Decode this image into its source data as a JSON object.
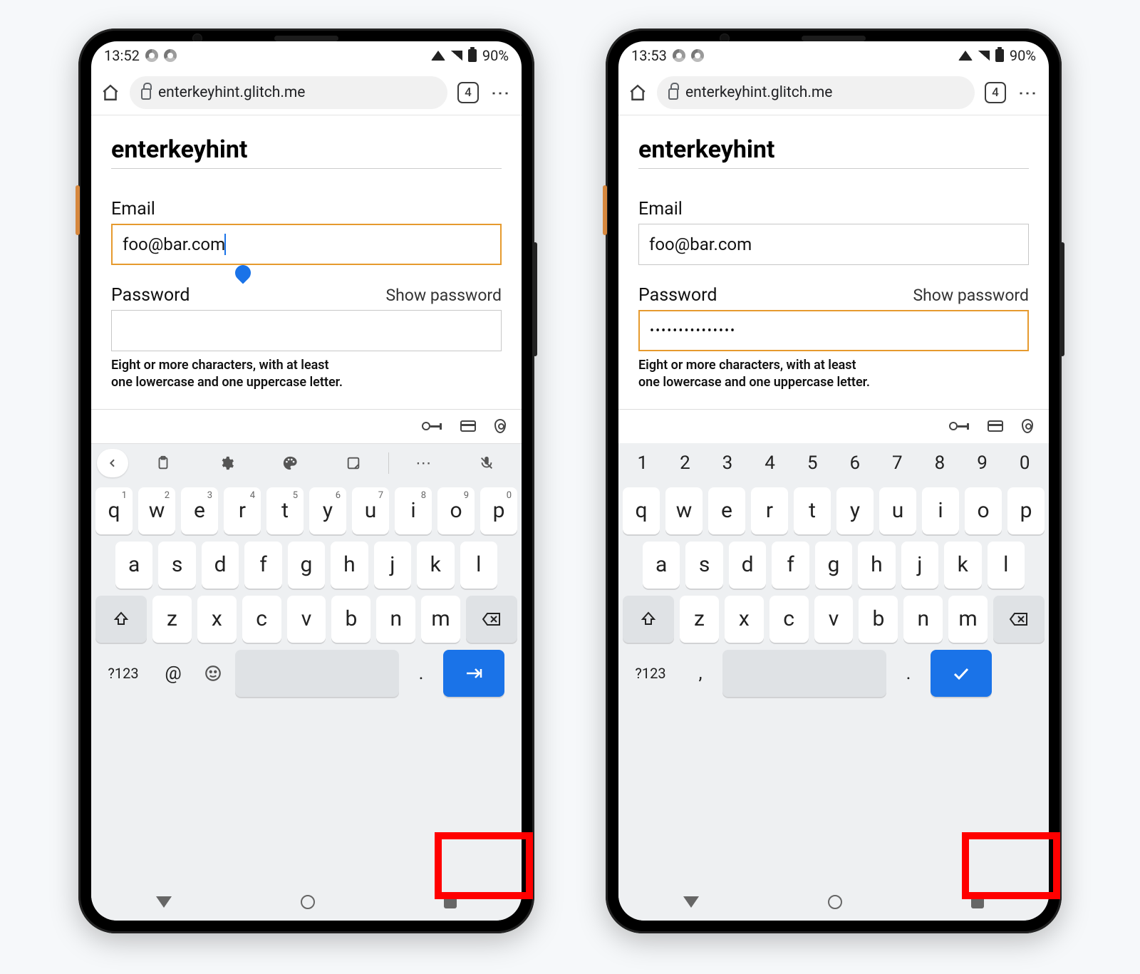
{
  "phones": [
    {
      "status": {
        "time": "13:52",
        "battery": "90%"
      },
      "browser": {
        "url": "enterkeyhint.glitch.me",
        "tab_count": "4"
      },
      "page": {
        "heading": "enterkeyhint",
        "email_label": "Email",
        "email_value": "foo@bar.com",
        "email_focused": true,
        "password_label": "Password",
        "show_password": "Show password",
        "password_value": "",
        "password_focused": false,
        "hint_line1": "Eight or more characters, with at least",
        "hint_line2": "one lowercase and one uppercase letter."
      },
      "keyboard": {
        "has_gboard_toolbar": true,
        "has_number_row": false,
        "row1": [
          "q",
          "w",
          "e",
          "r",
          "t",
          "y",
          "u",
          "i",
          "o",
          "p"
        ],
        "row1_sup": [
          "1",
          "2",
          "3",
          "4",
          "5",
          "6",
          "7",
          "8",
          "9",
          "0"
        ],
        "row2": [
          "a",
          "s",
          "d",
          "f",
          "g",
          "h",
          "j",
          "k",
          "l"
        ],
        "row3": [
          "z",
          "x",
          "c",
          "v",
          "b",
          "n",
          "m"
        ],
        "q123": "?123",
        "last_left1": "@",
        "last_left2": "emoji",
        "dot": ".",
        "enter_type": "next"
      }
    },
    {
      "status": {
        "time": "13:53",
        "battery": "90%"
      },
      "browser": {
        "url": "enterkeyhint.glitch.me",
        "tab_count": "4"
      },
      "page": {
        "heading": "enterkeyhint",
        "email_label": "Email",
        "email_value": "foo@bar.com",
        "email_focused": false,
        "password_label": "Password",
        "show_password": "Show password",
        "password_value": "•••••••••••••••",
        "password_focused": true,
        "hint_line1": "Eight or more characters, with at least",
        "hint_line2": "one lowercase and one uppercase letter."
      },
      "keyboard": {
        "has_gboard_toolbar": false,
        "has_number_row": true,
        "numrow": [
          "1",
          "2",
          "3",
          "4",
          "5",
          "6",
          "7",
          "8",
          "9",
          "0"
        ],
        "row1": [
          "q",
          "w",
          "e",
          "r",
          "t",
          "y",
          "u",
          "i",
          "o",
          "p"
        ],
        "row1_sup": null,
        "row2": [
          "a",
          "s",
          "d",
          "f",
          "g",
          "h",
          "j",
          "k",
          "l"
        ],
        "row3": [
          "z",
          "x",
          "c",
          "v",
          "b",
          "n",
          "m"
        ],
        "q123": "?123",
        "last_left1": ",",
        "last_left2": null,
        "dot": ".",
        "enter_type": "done"
      }
    }
  ]
}
